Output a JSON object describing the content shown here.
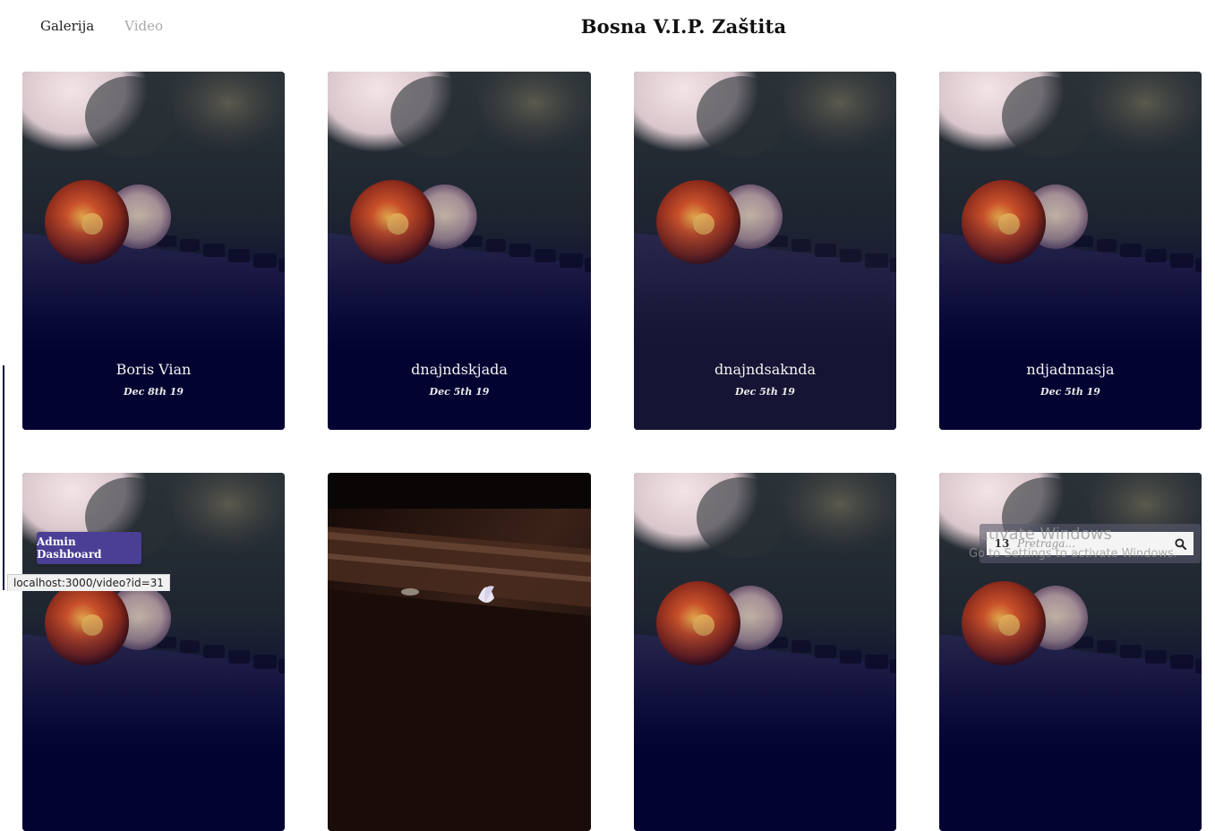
{
  "nav": {
    "gallery_label": "Galerija",
    "video_label": "Video"
  },
  "site_title": "Bosna V.I.P. Zaštita",
  "cards": [
    {
      "title": "Boris Vian",
      "date": "Dec 8th 19"
    },
    {
      "title": "dnajndskjada",
      "date": "Dec 5th 19"
    },
    {
      "title": "dnajndsaknda",
      "date": "Dec 5th 19"
    },
    {
      "title": "ndjadnnasja",
      "date": "Dec 5th 19"
    },
    {
      "title": "",
      "date": ""
    },
    {
      "title": "",
      "date": ""
    },
    {
      "title": "",
      "date": ""
    },
    {
      "title": "",
      "date": ""
    }
  ],
  "admin_button_label": "Admin Dashboard",
  "status_url": "localhost:3000/video?id=31",
  "search": {
    "count": "13",
    "placeholder": "Pretraga...",
    "icon": "search-icon"
  },
  "watermark": {
    "line1": "Activate Windows",
    "line2": "Go to Settings to activate Windows."
  },
  "colors": {
    "card_bottom": "#03032f",
    "admin_button": "#4a3f95"
  }
}
